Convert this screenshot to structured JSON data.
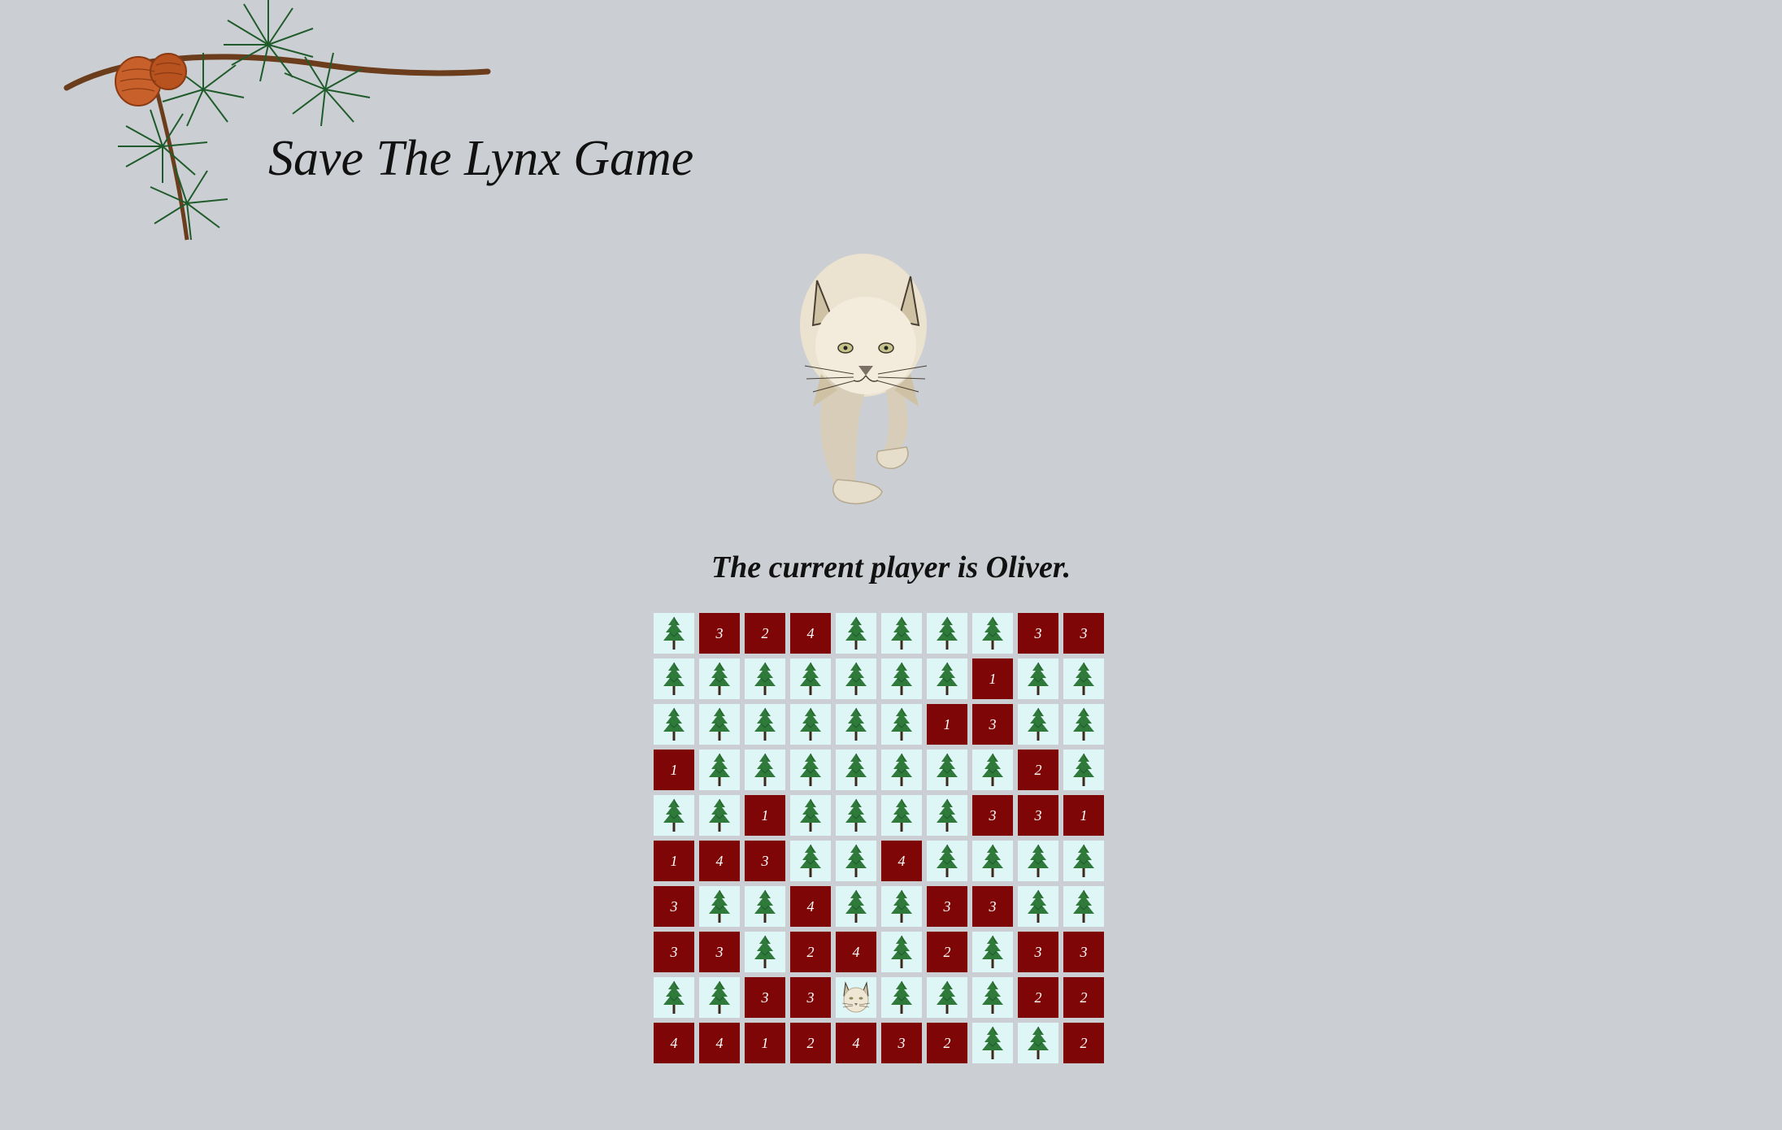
{
  "title": "Save The Lynx Game",
  "status": {
    "player_text": "The current player is Oliver."
  },
  "colors": {
    "background": "#cbced2",
    "revealed_cell": "#7f0606",
    "tree_cell": "#dff6f6",
    "tree": "#2f7a3a"
  },
  "icons": {
    "branch": "pine-branch-icon",
    "hero": "lynx-icon",
    "tree": "pine-tree-icon"
  },
  "board": {
    "rows": [
      [
        "T",
        "3",
        "2",
        "4",
        "T",
        "T",
        "T",
        "T",
        "3",
        "3"
      ],
      [
        "T",
        "T",
        "T",
        "T",
        "T",
        "T",
        "T",
        "1",
        "T",
        "T"
      ],
      [
        "T",
        "T",
        "T",
        "T",
        "T",
        "T",
        "1",
        "3",
        "T",
        "T"
      ],
      [
        "1",
        "T",
        "T",
        "T",
        "T",
        "T",
        "T",
        "T",
        "2",
        "T"
      ],
      [
        "T",
        "T",
        "1",
        "T",
        "T",
        "T",
        "T",
        "3",
        "3",
        "1"
      ],
      [
        "1",
        "4",
        "3",
        "T",
        "T",
        "4",
        "T",
        "T",
        "T",
        "T"
      ],
      [
        "3",
        "T",
        "T",
        "4",
        "T",
        "T",
        "3",
        "3",
        "T",
        "T"
      ],
      [
        "3",
        "3",
        "T",
        "2",
        "4",
        "T",
        "2",
        "T",
        "3",
        "3"
      ],
      [
        "T",
        "T",
        "3",
        "3",
        "L",
        "T",
        "T",
        "T",
        "2",
        "2"
      ],
      [
        "4",
        "4",
        "1",
        "2",
        "4",
        "3",
        "2",
        "T",
        "T",
        "2"
      ]
    ]
  }
}
